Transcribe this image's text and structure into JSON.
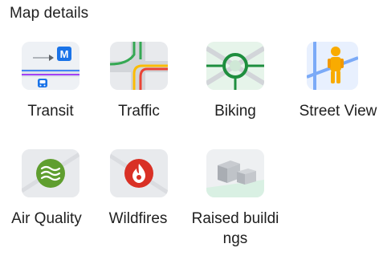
{
  "section": {
    "title": "Map details"
  },
  "layers": [
    {
      "id": "transit",
      "label": "Transit",
      "icon": "transit-map-icon"
    },
    {
      "id": "traffic",
      "label": "Traffic",
      "icon": "traffic-map-icon"
    },
    {
      "id": "biking",
      "label": "Biking",
      "icon": "biking-map-icon"
    },
    {
      "id": "street-view",
      "label": "Street View",
      "icon": "street-view-pegman-icon"
    },
    {
      "id": "air-quality",
      "label": "Air Quality",
      "icon": "air-quality-icon"
    },
    {
      "id": "wildfires",
      "label": "Wildfires",
      "icon": "wildfire-icon"
    },
    {
      "id": "raised-buildings",
      "label": "Raised buildings",
      "icon": "raised-buildings-icon"
    }
  ],
  "transit_glyph": "M",
  "colors": {
    "transit_blue": "#4285f4",
    "transit_purple": "#a142f4",
    "traffic_green": "#34a853",
    "traffic_yellow": "#fbbc04",
    "traffic_red": "#ea4335",
    "biking_green": "#1e8e3e",
    "pegman_yellow": "#f9ab00",
    "air_green": "#5f9e2f",
    "fire_red": "#d93025"
  }
}
